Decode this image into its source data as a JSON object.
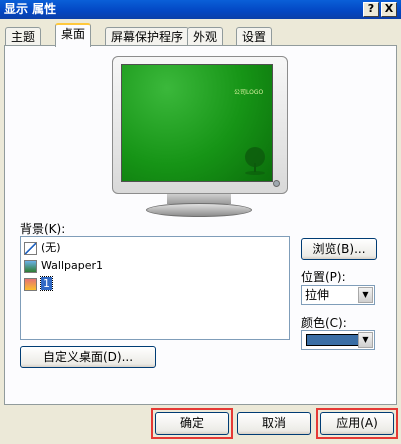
{
  "window": {
    "title": "显示 属性",
    "help_glyph": "?",
    "close_glyph": "X"
  },
  "tabs": [
    {
      "label": "主题"
    },
    {
      "label": "桌面"
    },
    {
      "label": "屏幕保护程序"
    },
    {
      "label": "外观"
    },
    {
      "label": "设置"
    }
  ],
  "active_tab": "桌面",
  "preview": {
    "screen_text": "公司LOGO"
  },
  "background": {
    "label": "背景(K):",
    "items": [
      {
        "label": "(无)",
        "icon": "no-wallpaper-icon"
      },
      {
        "label": "Wallpaper1",
        "icon": "image-file-icon"
      },
      {
        "label": "1",
        "icon": "html-file-icon",
        "selected": true
      }
    ]
  },
  "controls": {
    "browse_label": "浏览(B)...",
    "position_label": "位置(P):",
    "position_value": "拉伸",
    "color_label": "颜色(C):",
    "color_value": "#3a6ea5",
    "customize_label": "自定义桌面(D)..."
  },
  "footer": {
    "ok_label": "确定",
    "cancel_label": "取消",
    "apply_label": "应用(A)"
  },
  "colors": {
    "title_bar": "#0346c2",
    "annotation": "#e53935"
  }
}
